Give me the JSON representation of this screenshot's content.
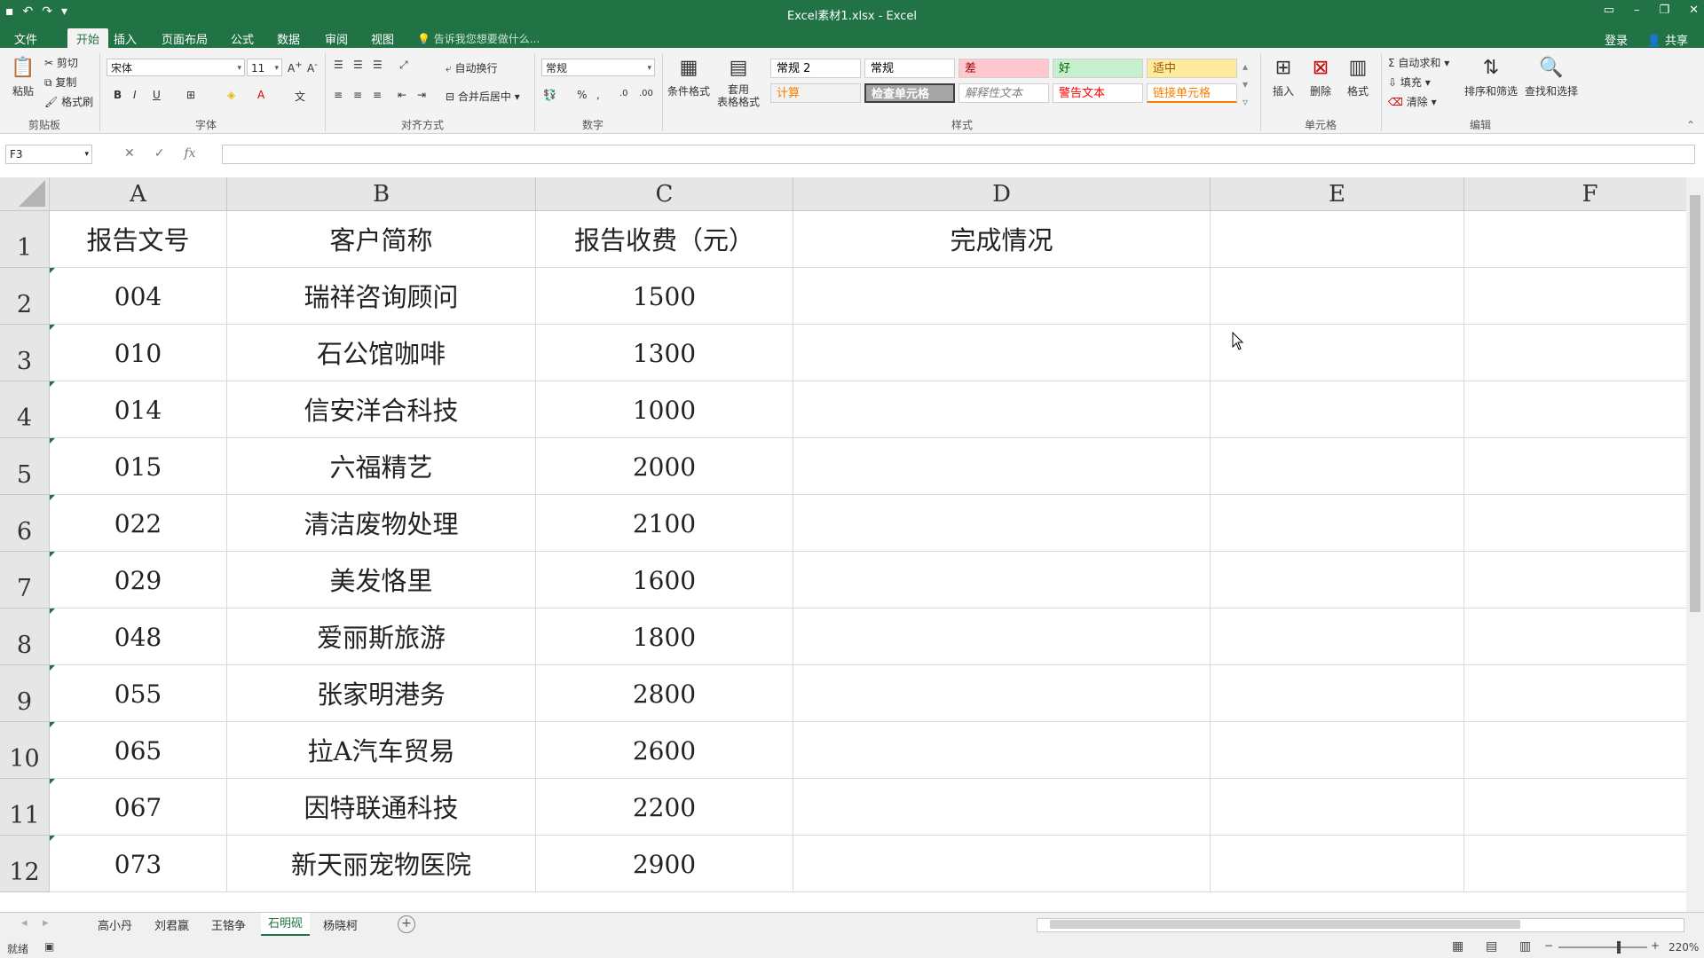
{
  "window": {
    "title": "Excel素材1.xlsx - Excel",
    "login": "登录",
    "share": "共享"
  },
  "ribbon": {
    "tabs": [
      "文件",
      "开始",
      "插入",
      "页面布局",
      "公式",
      "数据",
      "审阅",
      "视图"
    ],
    "active_tab": "开始",
    "tell_me": "告诉我您想要做什么...",
    "clipboard": {
      "paste": "粘贴",
      "cut": "剪切",
      "copy": "复制",
      "format_painter": "格式刷",
      "label": "剪贴板"
    },
    "font": {
      "name": "宋体",
      "size": "11",
      "label": "字体"
    },
    "alignment": {
      "wrap": "自动换行",
      "merge": "合并后居中",
      "label": "对齐方式"
    },
    "number": {
      "format": "常规",
      "label": "数字"
    },
    "styles": {
      "conditional": "条件格式",
      "table_format": "套用\n表格格式",
      "cells": [
        {
          "text": "常规 2",
          "bg": "#ffffff",
          "color": "#000000"
        },
        {
          "text": "常规",
          "bg": "#ffffff",
          "color": "#000000"
        },
        {
          "text": "差",
          "bg": "#ffc7ce",
          "color": "#9c0006"
        },
        {
          "text": "好",
          "bg": "#c6efce",
          "color": "#006100"
        },
        {
          "text": "适中",
          "bg": "#ffeb9c",
          "color": "#9c5700"
        },
        {
          "text": "计算",
          "bg": "#f2f2f2",
          "color": "#fa7d00"
        },
        {
          "text": "检查单元格",
          "bg": "#a5a5a5",
          "color": "#ffffff"
        },
        {
          "text": "解释性文本",
          "bg": "#ffffff",
          "color": "#7f7f7f"
        },
        {
          "text": "警告文本",
          "bg": "#ffffff",
          "color": "#ff0000"
        },
        {
          "text": "链接单元格",
          "bg": "#ffffff",
          "color": "#fa7d00"
        }
      ],
      "label": "样式"
    },
    "cells_group": {
      "insert": "插入",
      "delete": "删除",
      "format": "格式",
      "label": "单元格"
    },
    "editing": {
      "autosum": "自动求和",
      "fill": "填充",
      "clear": "清除",
      "sort": "排序和筛选",
      "find": "查找和选择",
      "label": "编辑"
    }
  },
  "formula_bar": {
    "name_box": "F3",
    "fx": "fx",
    "value": ""
  },
  "grid": {
    "columns": [
      "A",
      "B",
      "C",
      "D",
      "E",
      "F"
    ],
    "rows": [
      "1",
      "2",
      "3",
      "4",
      "5",
      "6",
      "7",
      "8",
      "9",
      "10",
      "11",
      "12"
    ],
    "header": [
      "报告文号",
      "客户简称",
      "报告收费（元）",
      "完成情况"
    ],
    "data": [
      [
        "004",
        "瑞祥咨询顾问",
        "1500",
        ""
      ],
      [
        "010",
        "石公馆咖啡",
        "1300",
        ""
      ],
      [
        "014",
        "信安洋合科技",
        "1000",
        ""
      ],
      [
        "015",
        "六福精艺",
        "2000",
        ""
      ],
      [
        "022",
        "清洁废物处理",
        "2100",
        ""
      ],
      [
        "029",
        "美发恪里",
        "1600",
        ""
      ],
      [
        "048",
        "爱丽斯旅游",
        "1800",
        ""
      ],
      [
        "055",
        "张家明港务",
        "2800",
        ""
      ],
      [
        "065",
        "拉A汽车贸易",
        "2600",
        ""
      ],
      [
        "067",
        "因特联通科技",
        "2200",
        ""
      ],
      [
        "073",
        "新天丽宠物医院",
        "2900",
        ""
      ]
    ]
  },
  "sheets": {
    "tabs": [
      "高小丹",
      "刘君赢",
      "王铬争",
      "石明砚",
      "杨晓柯"
    ],
    "active": "石明砚"
  },
  "status": {
    "ready": "就绪",
    "zoom": "220%"
  },
  "colors": {
    "accent": "#217346"
  }
}
